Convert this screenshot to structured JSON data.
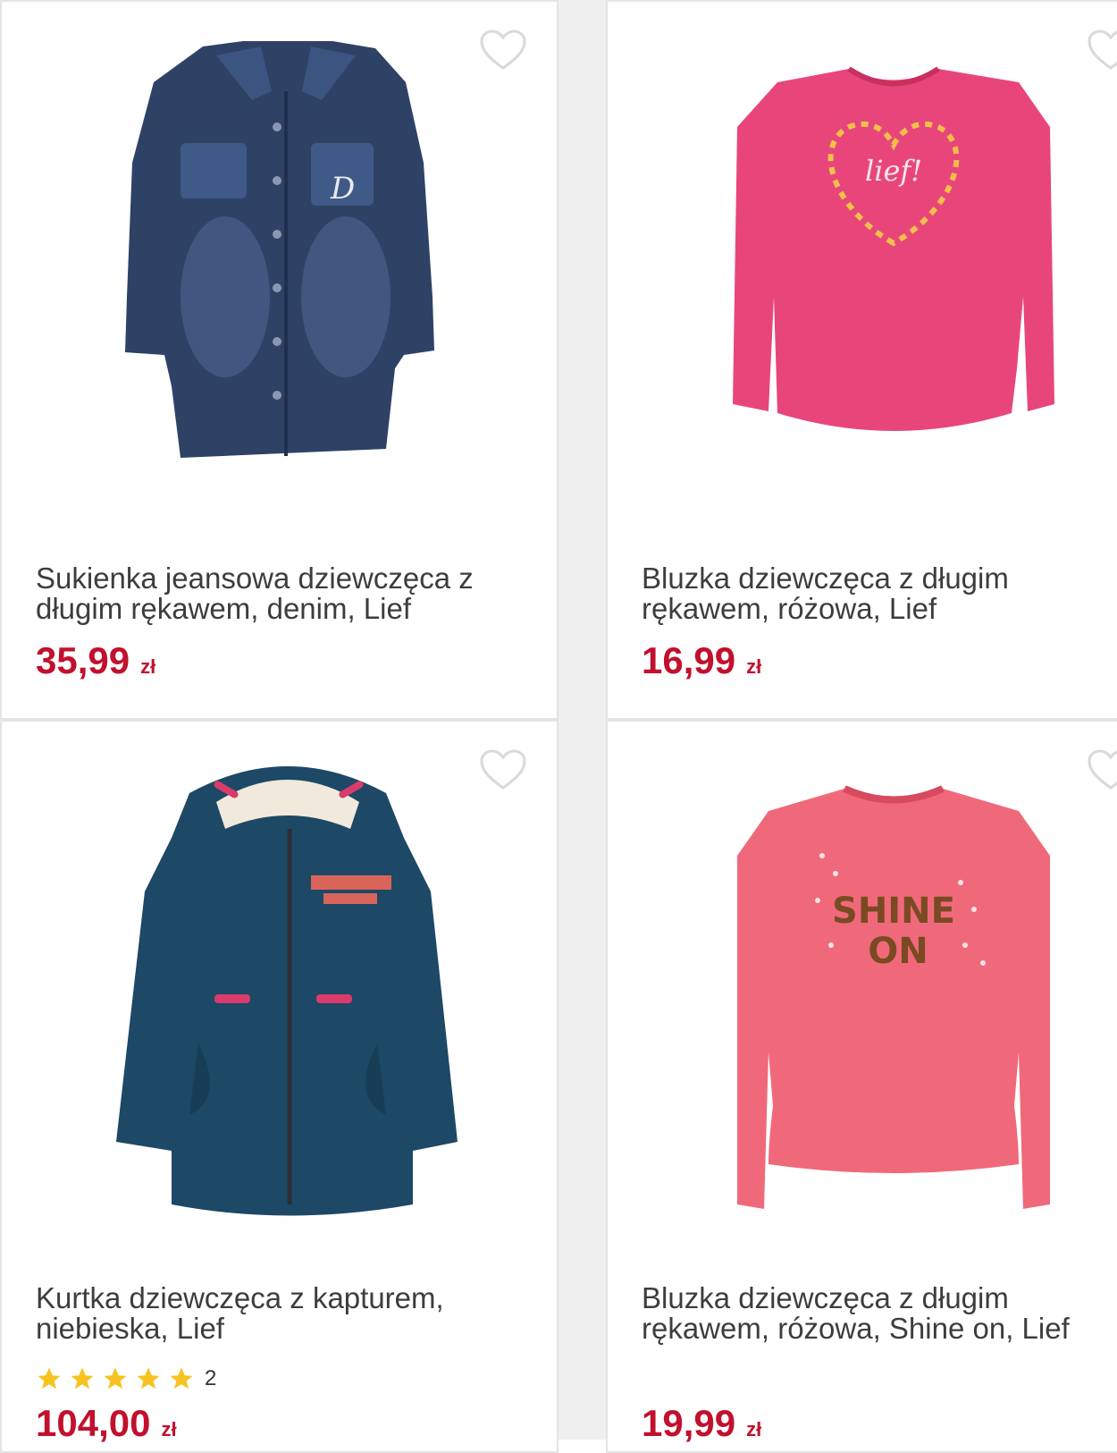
{
  "products": [
    {
      "title_line1": "Sukienka jeansowa dziewczęca z",
      "title_line2": "długim rękawem, denim, Lief",
      "price": "35,99",
      "currency": "zł",
      "image_icon": "denim-dress-image",
      "colors": {
        "main": "#2e4266",
        "accent": "#4c6490"
      }
    },
    {
      "title_line1": "Bluzka dziewczęca z długim",
      "title_line2": "rękawem, różowa, Lief",
      "price": "16,99",
      "currency": "zł",
      "image_icon": "pink-blouse-image",
      "colors": {
        "main": "#e8467a",
        "accent": "#f2c04a"
      }
    },
    {
      "title_line1": "Kurtka dziewczęca z kapturem,",
      "title_line2": "niebieska, Lief",
      "rating_stars": 5,
      "rating_count": "2",
      "price": "104,00",
      "currency": "zł",
      "image_icon": "hooded-jacket-image",
      "colors": {
        "main": "#1d4866",
        "accent": "#d93b6b"
      }
    },
    {
      "title_line1": "Bluzka dziewczęca z długim",
      "title_line2": "rękawem, różowa, Shine on, Lief",
      "price": "19,99",
      "currency": "zł",
      "image_icon": "coral-blouse-image",
      "print_text_1": "SHINE",
      "print_text_2": "ON",
      "colors": {
        "main": "#f0697a",
        "accent": "#7a4a22"
      }
    }
  ],
  "colors": {
    "price": "#c2102d",
    "title": "#3d3d3d",
    "star": "#f6c320",
    "heart_outline": "#d9d9d9"
  }
}
